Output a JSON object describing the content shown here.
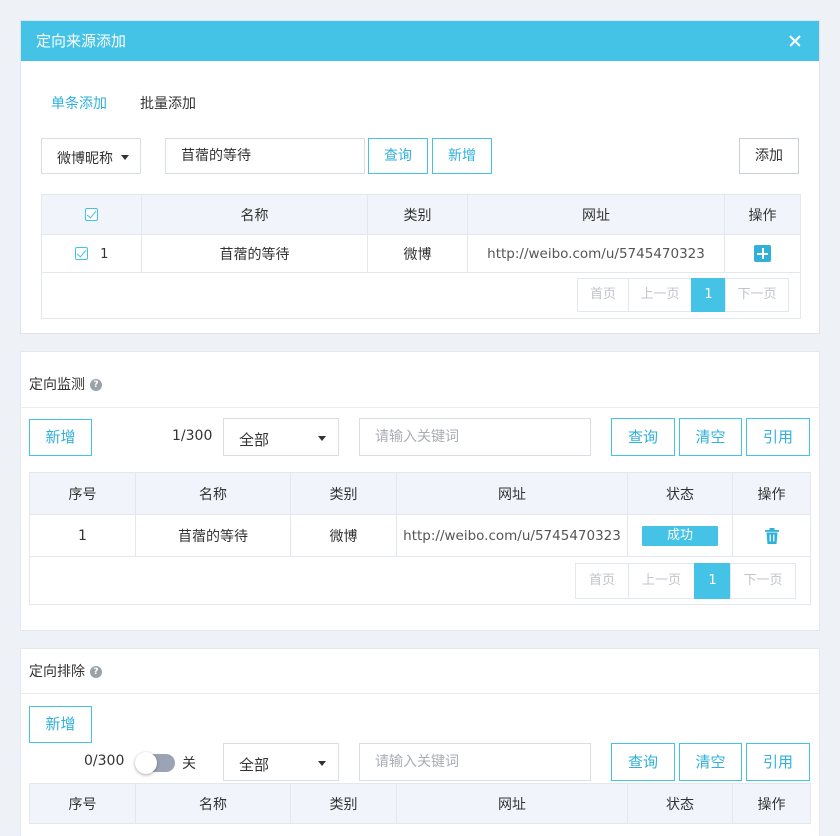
{
  "dialog": {
    "title": "定向来源添加",
    "tabs": [
      "单条添加",
      "批量添加"
    ],
    "search_type": "微博昵称",
    "search_value": "苜蓿的等待",
    "buttons": {
      "query": "查询",
      "new": "新增",
      "add": "添加"
    },
    "table": {
      "headers": [
        "名称",
        "类别",
        "网址",
        "操作"
      ],
      "rows": [
        {
          "index": "1",
          "name": "苜蓿的等待",
          "category": "微博",
          "url": "http://weibo.com/u/5745470323"
        }
      ]
    },
    "pager": {
      "first": "首页",
      "prev": "上一页",
      "current": "1",
      "next": "下一页"
    }
  },
  "monitor": {
    "title": "定向监测",
    "buttons": {
      "new": "新增",
      "query": "查询",
      "clear": "清空",
      "quote": "引用"
    },
    "count": "1/300",
    "filter": "全部",
    "keyword_placeholder": "请输入关键词",
    "table": {
      "headers": [
        "序号",
        "名称",
        "类别",
        "网址",
        "状态",
        "操作"
      ],
      "rows": [
        {
          "index": "1",
          "name": "苜蓿的等待",
          "category": "微博",
          "url": "http://weibo.com/u/5745470323",
          "status": "成功"
        }
      ]
    },
    "pager": {
      "first": "首页",
      "prev": "上一页",
      "current": "1",
      "next": "下一页"
    }
  },
  "exclude": {
    "title": "定向排除",
    "buttons": {
      "new": "新增",
      "query": "查询",
      "clear": "清空",
      "quote": "引用"
    },
    "count": "0/300",
    "toggle_label": "关",
    "toggle_on": false,
    "filter": "全部",
    "keyword_placeholder": "请输入关键词",
    "table": {
      "headers": [
        "序号",
        "名称",
        "类别",
        "网址",
        "状态",
        "操作"
      ]
    }
  },
  "colors": {
    "accent": "#44c3e6",
    "accent_text": "#2fb1d9",
    "header_bg": "#f1f5fb",
    "page_bg": "#eef2f7"
  }
}
